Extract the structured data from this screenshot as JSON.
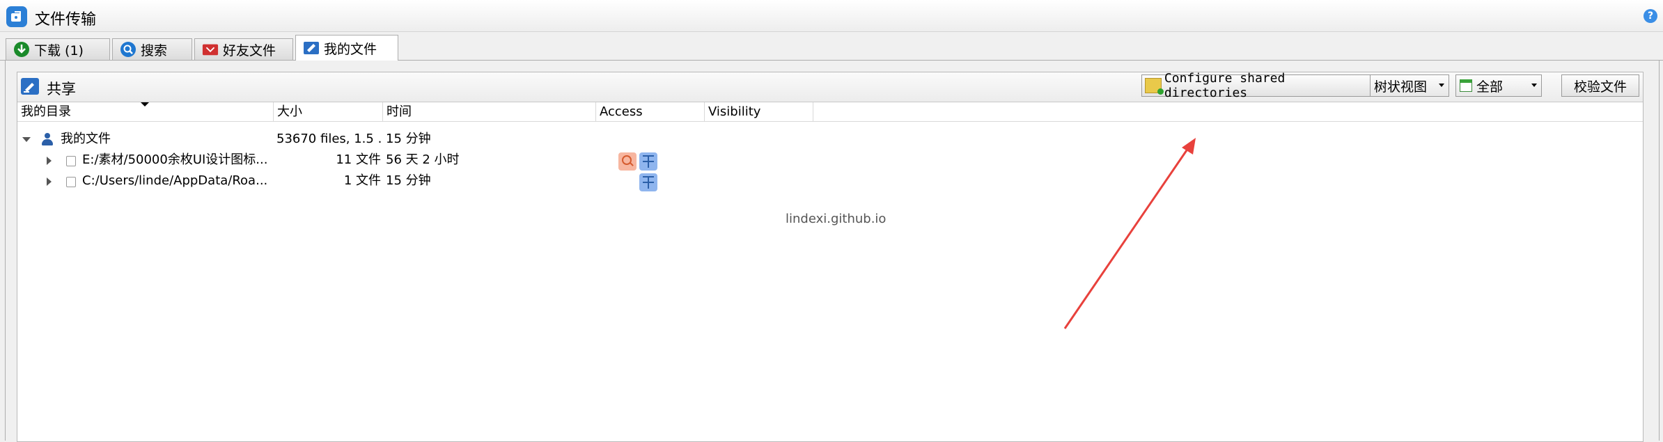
{
  "window": {
    "title": "文件传输",
    "help": "?"
  },
  "tabs": [
    {
      "label": "下载 (1)",
      "icon": "download-icon",
      "color": "#1a8a2a"
    },
    {
      "label": "搜索",
      "icon": "search-icon",
      "color": "#1f77d0"
    },
    {
      "label": "好友文件",
      "icon": "friend-files-icon",
      "color": "#d03030"
    },
    {
      "label": "我的文件",
      "icon": "my-files-icon",
      "color": "#2b6fc4",
      "active": true
    }
  ],
  "share": {
    "title": "共享",
    "configure_label": "Configure shared directories",
    "view_select": "树状视图",
    "filter_select": "全部",
    "verify_label": "校验文件"
  },
  "columns": [
    "我的目录",
    "大小",
    "时间",
    "Access",
    "Visibility"
  ],
  "rows": [
    {
      "name": "我的文件",
      "size": "53670 files, 1.5 ...",
      "time": "15 分钟",
      "expanded": true,
      "level": 0
    },
    {
      "name": "E:/素材/50000余枚UI设计图标...",
      "size": "11 文件",
      "time": "56 天 2 小时",
      "level": 1,
      "access": [
        "search-access-icon",
        "network-access-icon"
      ]
    },
    {
      "name": "C:/Users/linde/AppData/Roa...",
      "size": "1 文件",
      "time": "15 分钟",
      "level": 1,
      "access": [
        "network-access-icon"
      ]
    }
  ],
  "watermark": "lindexi.github.io",
  "colors": {
    "annotation_arrow": "#e8413c",
    "accent": "#2b7fd6"
  }
}
